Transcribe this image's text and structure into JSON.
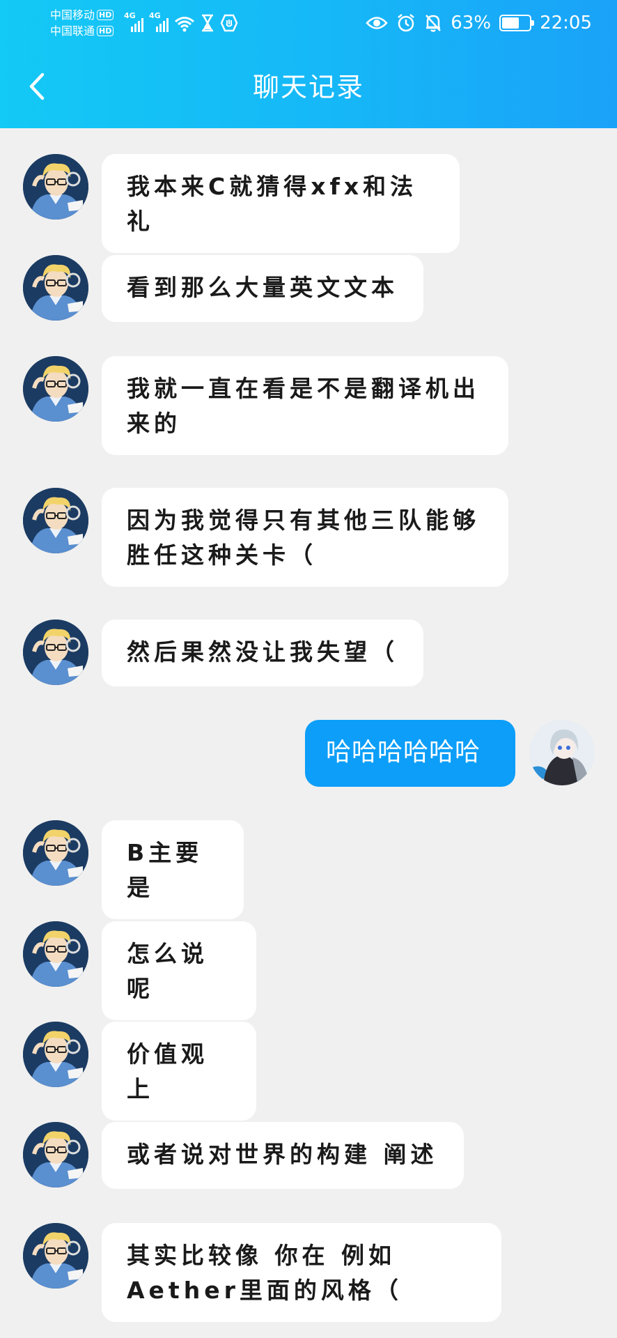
{
  "status_bar": {
    "carrier1": "中国移动",
    "carrier2": "中国联通",
    "hd": "HD",
    "network": "4G",
    "battery_percent": "63%",
    "battery_level": 0.63,
    "time": "22:05",
    "icons": [
      "wifi-icon",
      "hourglass-icon",
      "shield-icon",
      "eye-icon",
      "alarm-icon",
      "bell-muted-icon",
      "battery-icon"
    ]
  },
  "header": {
    "title": "聊天记录",
    "back_icon": "chevron-left-icon"
  },
  "colors": {
    "header_gradient_start": "#13c9f5",
    "header_gradient_end": "#1aa2f8",
    "chat_background": "#f0f0f0",
    "incoming_bubble": "#ffffff",
    "outgoing_bubble": "#0c9ef8"
  },
  "messages": [
    {
      "side": "left",
      "text": "我本来C就猜得xfx和法礼"
    },
    {
      "side": "left",
      "text": "看到那么大量英文文本"
    },
    {
      "side": "left",
      "text": "我就一直在看是不是翻译机出来的"
    },
    {
      "side": "left",
      "text": "因为我觉得只有其他三队能够胜任这种关卡（"
    },
    {
      "side": "left",
      "text": "然后果然没让我失望（"
    },
    {
      "side": "right",
      "text": "哈哈哈哈哈哈"
    },
    {
      "side": "left",
      "text": "B主要是"
    },
    {
      "side": "left",
      "text": "怎么说呢"
    },
    {
      "side": "left",
      "text": "价值观上"
    },
    {
      "side": "left",
      "text": "或者说对世界的构建 阐述"
    },
    {
      "side": "left",
      "text": "其实比较像 你在 例如Aether里面的风格（"
    }
  ]
}
